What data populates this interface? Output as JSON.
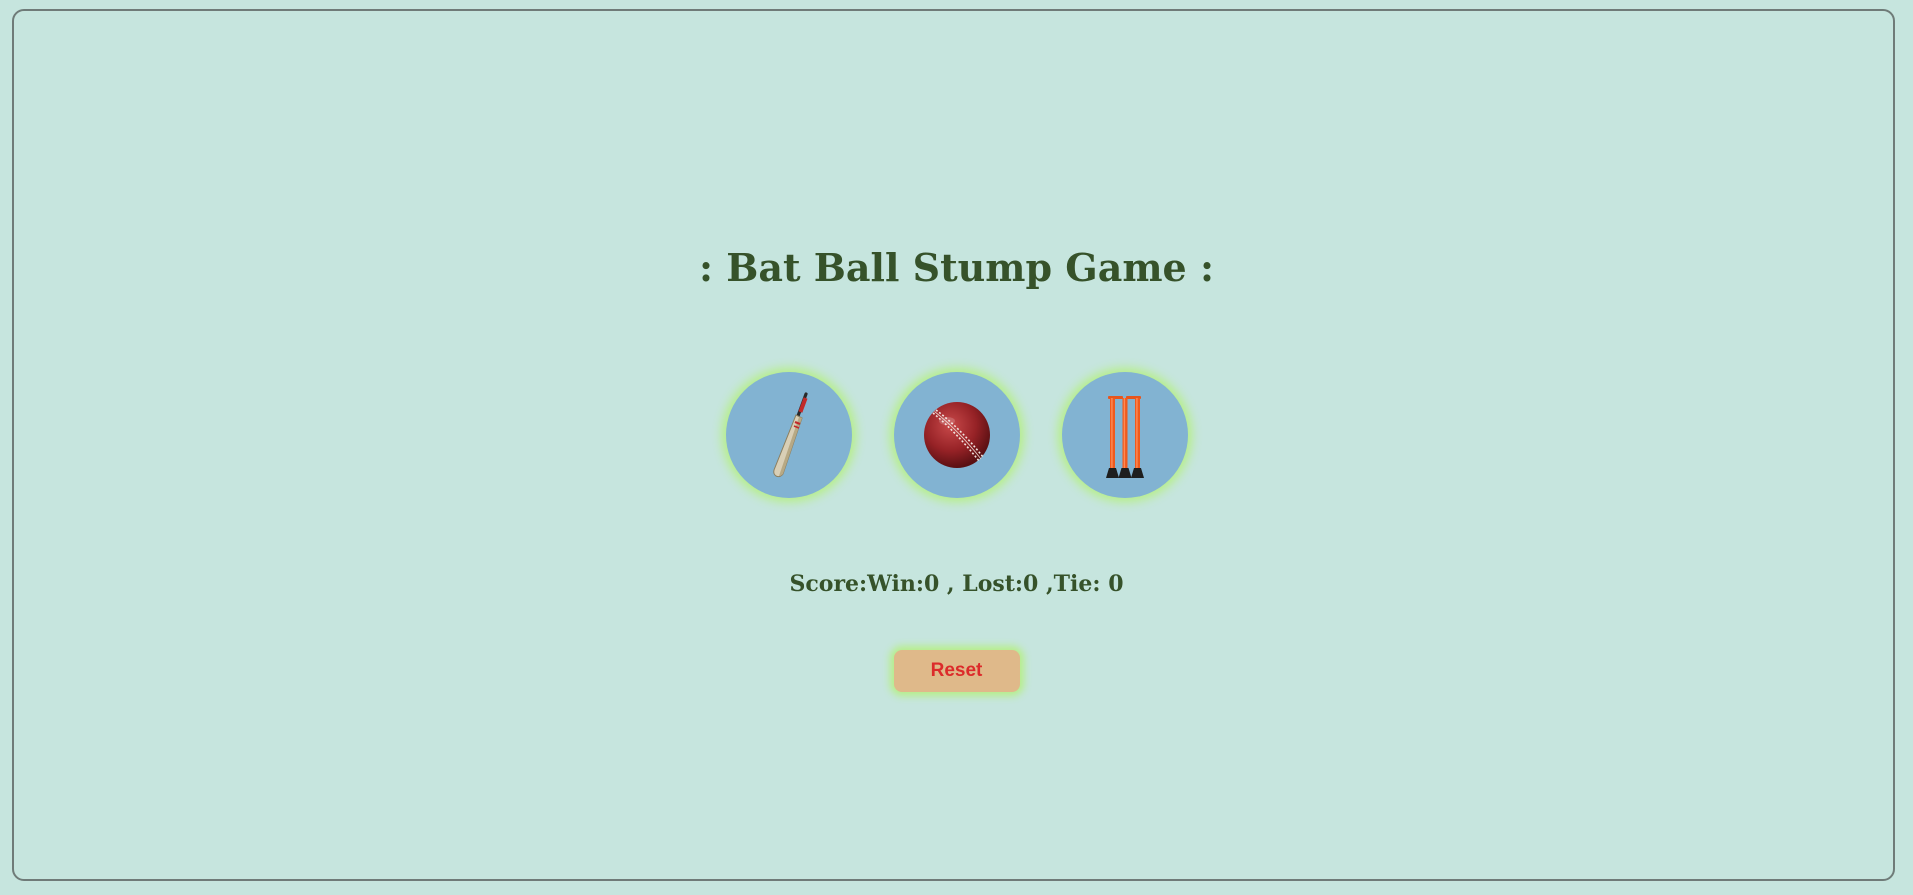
{
  "game": {
    "title": ": Bat Ball Stump Game :",
    "choices": [
      {
        "label": "Bat",
        "icon": "bat-icon"
      },
      {
        "label": "Ball",
        "icon": "ball-icon"
      },
      {
        "label": "Stump",
        "icon": "stump-icon"
      }
    ],
    "score_text": "Score:Win:0 , Lost:0 ,Tie: 0",
    "score": {
      "win": 0,
      "lost": 0,
      "tie": 0
    },
    "reset_label": "Reset"
  },
  "colors": {
    "background": "#c6e5de",
    "title": "#36522a",
    "circle": "#82b3d2",
    "glow": "#b6ef86",
    "reset_bg": "#dfb98a",
    "reset_text": "#dc2b2b"
  }
}
